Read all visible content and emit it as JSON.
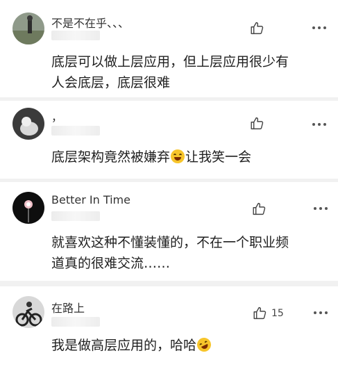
{
  "comments": [
    {
      "username": "不是不在乎、、、",
      "avatar_icon": "avatar-photo-outdoor",
      "likes": "",
      "lines": [
        "底层可以做上层应用，但上层应用很少有",
        "人会底层，底层很难"
      ]
    },
    {
      "username": "，",
      "avatar_icon": "avatar-photo-cat",
      "likes": "",
      "lines": [
        "底层架构竟然被嫌弃",
        "让我笑一会"
      ],
      "emoji": "laughing-tears-emoji"
    },
    {
      "username": "Better In Time",
      "avatar_icon": "avatar-dandelion",
      "likes": "",
      "lines": [
        "就喜欢这种不懂装懂的，不在一个职业频",
        "道真的很难交流……"
      ]
    },
    {
      "username": "在路上",
      "avatar_icon": "avatar-motorcycle",
      "likes": "15",
      "lines": [
        "我是做高层应用的，哈哈"
      ],
      "emoji": "rolling-laughing-emoji"
    }
  ]
}
